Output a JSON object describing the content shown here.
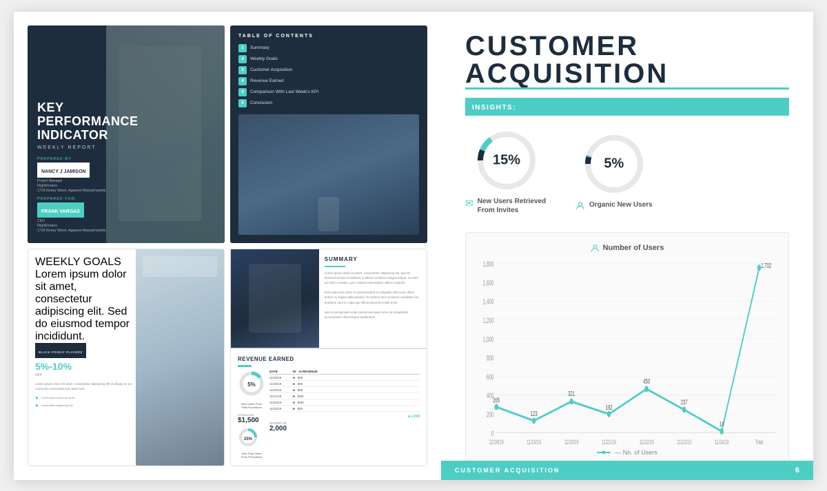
{
  "page": {
    "title": "CUSTOMER ACQUISITION",
    "title_line1": "CUSTOMER",
    "title_line2": "ACQUISITION"
  },
  "insights": {
    "badge": "INSIGHTS:"
  },
  "metrics": [
    {
      "value": "15%",
      "percentage": 15,
      "label": "New Users Retrieved From Invites",
      "icon": "✉"
    },
    {
      "value": "5%",
      "percentage": 5,
      "label": "Organic New Users",
      "icon": "👤"
    }
  ],
  "chart": {
    "title": "Number of Users",
    "icon": "👤",
    "legend": "— No. of Users",
    "yAxis": [
      "1,800",
      "1,600",
      "1,400",
      "1,200",
      "1,000",
      "800",
      "600",
      "400",
      "200",
      "0"
    ],
    "xAxis": [
      "11/18/19",
      "11/19/19",
      "11/20/19",
      "11/21/19",
      "11/22/19",
      "11/23/19",
      "11/24/19",
      "Total"
    ],
    "dataPoints": [
      {
        "label": "11/18/19",
        "value": 265
      },
      {
        "label": "11/19/19",
        "value": 123
      },
      {
        "label": "11/20/19",
        "value": 321
      },
      {
        "label": "11/21/19",
        "value": 192
      },
      {
        "label": "11/22/19",
        "value": 450
      },
      {
        "label": "11/23/19",
        "value": 237
      },
      {
        "label": "11/24/19",
        "value": 14
      },
      {
        "label": "Total",
        "value": 1702
      }
    ]
  },
  "footer": {
    "text": "CUSTOMER ACQUISITION",
    "page": "6"
  },
  "slides": {
    "slide1": {
      "title_line1": "KEY",
      "title_line2": "PERFORMANCE",
      "title_line3": "INDICATOR",
      "subtitle": "WEEKLY REPORT",
      "prepared_by": "PREPARED BY:",
      "name1": "NANCY J JAMISON",
      "name1_role": "Project Manager",
      "name1_company": "FlightFinders",
      "name1_address": "1718 Kinney Street, Agawam Massachusetts",
      "prepared_for": "PREPARED FOR:",
      "name2": "FRANK VARGAS",
      "name2_role": "CEO",
      "name2_company": "FlightFinders",
      "name2_address": "1718 Kinney Street, Agawam Massachusetts"
    },
    "slide2": {
      "title": "TABLE OF CONTENTS",
      "items": [
        {
          "num": "1",
          "label": "Summary"
        },
        {
          "num": "2",
          "label": "Weekly Goals"
        },
        {
          "num": "3",
          "label": "Customer Acquisition"
        },
        {
          "num": "4",
          "label": "Revenue Earned"
        },
        {
          "num": "5",
          "label": "Comparison With Last Week's KPI"
        },
        {
          "num": "6",
          "label": "Conclusion"
        }
      ]
    },
    "slide3": {
      "title": "WEEKLY GOALS",
      "badge": "BLACK FRIDAY PLAYERS",
      "percent": "5%-10%",
      "sub": "OFF"
    },
    "slide4": {
      "title": "SUMMARY"
    },
    "slide5": {
      "title": "REVENUE EARNED",
      "percent": "5%",
      "stat1_value": "$1,500",
      "stat1_label": "DOWNLOAD",
      "stat2_value": "2,000",
      "stat2_label": "SIGNED UP",
      "stat3_percent": "25%"
    }
  }
}
